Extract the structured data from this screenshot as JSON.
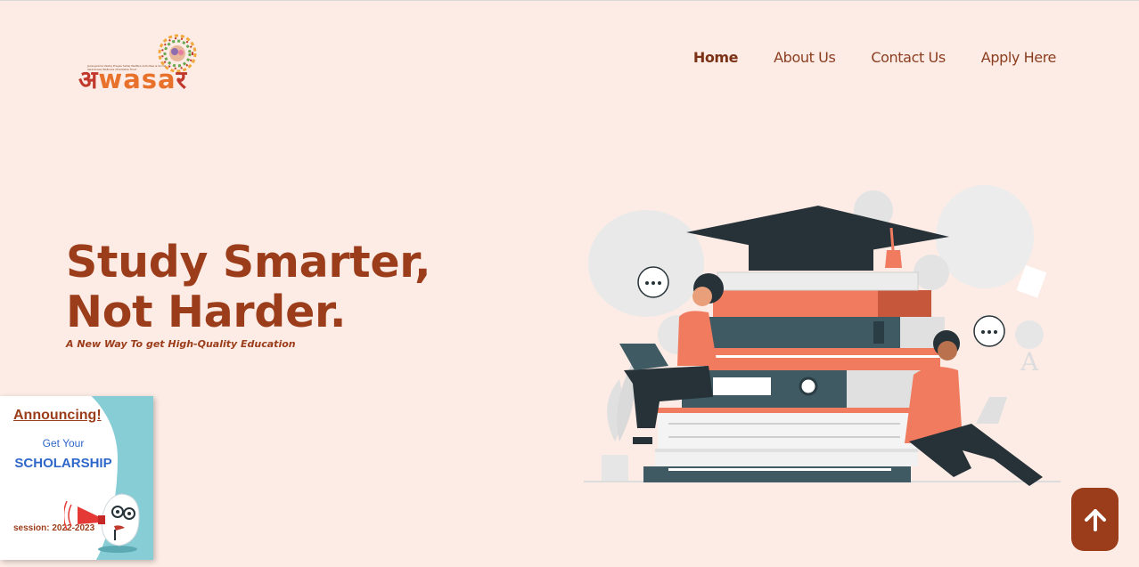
{
  "logo": {
    "text_prefix": "अ",
    "text_main": "wasa",
    "text_suffix": "र",
    "tagline": "Jansugrama Vastuj Prayas Sahej Welfare Activities & Social Awareness Wellness Charitable Trust"
  },
  "nav": {
    "items": [
      {
        "label": "Home",
        "active": true
      },
      {
        "label": "About Us",
        "active": false
      },
      {
        "label": "Contact Us",
        "active": false
      },
      {
        "label": "Apply Here",
        "active": false
      }
    ]
  },
  "hero": {
    "title": "Study Smarter, Not Harder.",
    "subtitle": "A New Way To get High-Quality Education"
  },
  "promo": {
    "heading": "Announcing!",
    "line1": "Get Your",
    "line2": "SCHOLARSHIP",
    "session": "session: 2022-2023"
  },
  "colors": {
    "background": "#fdece6",
    "brand": "#9b3d1a",
    "accent_blue": "#2e67c9",
    "promo_teal": "#86cdd6"
  },
  "icons": {
    "scroll_top": "arrow-up-icon"
  }
}
